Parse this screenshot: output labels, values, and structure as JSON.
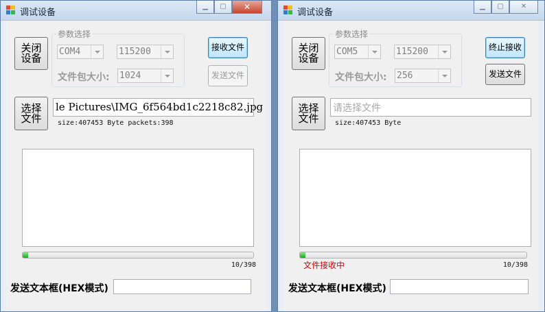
{
  "colors": {
    "title_bg": "#c6d8ee",
    "client_bg": "#f0f0f0",
    "status_red": "#e00000",
    "progress_green": "#14b014"
  },
  "left": {
    "title": "调试设备",
    "device_button": "关闭设备",
    "group_legend": "参数选择",
    "port": "COM4",
    "baud": "115200",
    "packet_size_label": "文件包大小:",
    "packet_size": "1024",
    "receive_button": "接收文件",
    "send_button": "发送文件",
    "select_file_button": "选择文件",
    "file_path": "le Pictures\\IMG_6f564bd1c2218c82.jpg",
    "file_info": "size:407453 Byte packets:398",
    "progress_fraction": 0.025,
    "progress_count": "10/398",
    "status": "",
    "send_text_label": "发送文本框(HEX模式)",
    "send_text_value": ""
  },
  "right": {
    "title": "调试设备",
    "device_button": "关闭设备",
    "group_legend": "参数选择",
    "port": "COM5",
    "baud": "115200",
    "packet_size_label": "文件包大小:",
    "packet_size": "256",
    "receive_button": "终止接收",
    "send_button": "发送文件",
    "select_file_button": "选择文件",
    "file_path_placeholder": "请选择文件",
    "file_info": "size:407453 Byte",
    "progress_fraction": 0.025,
    "progress_count": "10/398",
    "status": "文件接收中",
    "send_text_label": "发送文本框(HEX模式)",
    "send_text_value": ""
  },
  "icons": [
    "app-icon",
    "minimize-icon",
    "maximize-icon",
    "close-icon",
    "dropdown-arrow-icon"
  ]
}
